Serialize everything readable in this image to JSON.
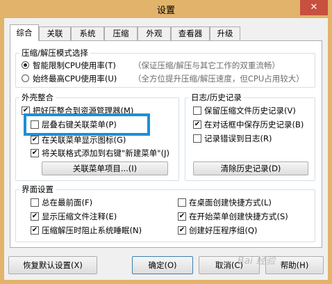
{
  "window": {
    "title": "设置",
    "close_glyph": "✕"
  },
  "tabs": [
    "综合",
    "关联",
    "系统",
    "压缩",
    "外观",
    "查看器",
    "升级"
  ],
  "compression_mode": {
    "title": "压缩/解压模式选择",
    "options": [
      {
        "label": "智能限制CPU使用率(T)",
        "hint": "（保证压缩/解压与其它工作的双重流畅）",
        "selected": true
      },
      {
        "label": "始终最高CPU使用率(U)",
        "hint": "（全方位提升压缩/解压速度，但CPU占用较大）",
        "selected": false
      }
    ]
  },
  "shell_integration": {
    "title": "外壳整合",
    "items": [
      {
        "label": "把好压整合到资源管理器(M)",
        "checked": true
      },
      {
        "label": "层叠右键关联菜单(P)",
        "checked": false
      },
      {
        "label": "在关联菜单显示图标(G)",
        "checked": true
      },
      {
        "label": "将关联格式添加到右键\"新建菜单\"(J)",
        "checked": true
      }
    ],
    "button_label": "关联菜单项目...(I)"
  },
  "history": {
    "title": "日志/历史记录",
    "items": [
      {
        "label": "保留压缩文件历史记录(V)",
        "checked": false
      },
      {
        "label": "在对话框中保存历史记录(B)",
        "checked": true
      },
      {
        "label": "记录错误到日志(R)",
        "checked": false
      }
    ],
    "button_label": "清除历史记录(D)"
  },
  "ui_settings": {
    "title": "界面设置",
    "items": [
      {
        "label": "总在最前面(F)",
        "checked": false
      },
      {
        "label": "在桌面创建快捷方式(L)",
        "checked": false
      },
      {
        "label": "显示压缩文件注释(E)",
        "checked": true
      },
      {
        "label": "在开始菜单创建快捷方式(S)",
        "checked": true
      },
      {
        "label": "压缩解压时阻止系统睡眠(N)",
        "checked": true
      },
      {
        "label": "创建好压程序组(Q)",
        "checked": true
      }
    ]
  },
  "buttons": {
    "restore_defaults": "恢复默认设置(X)",
    "ok": "确定(O)",
    "cancel": "取消(C)",
    "help": "帮助(H)"
  },
  "watermark": "Bai 经验",
  "check_glyph": "✔"
}
